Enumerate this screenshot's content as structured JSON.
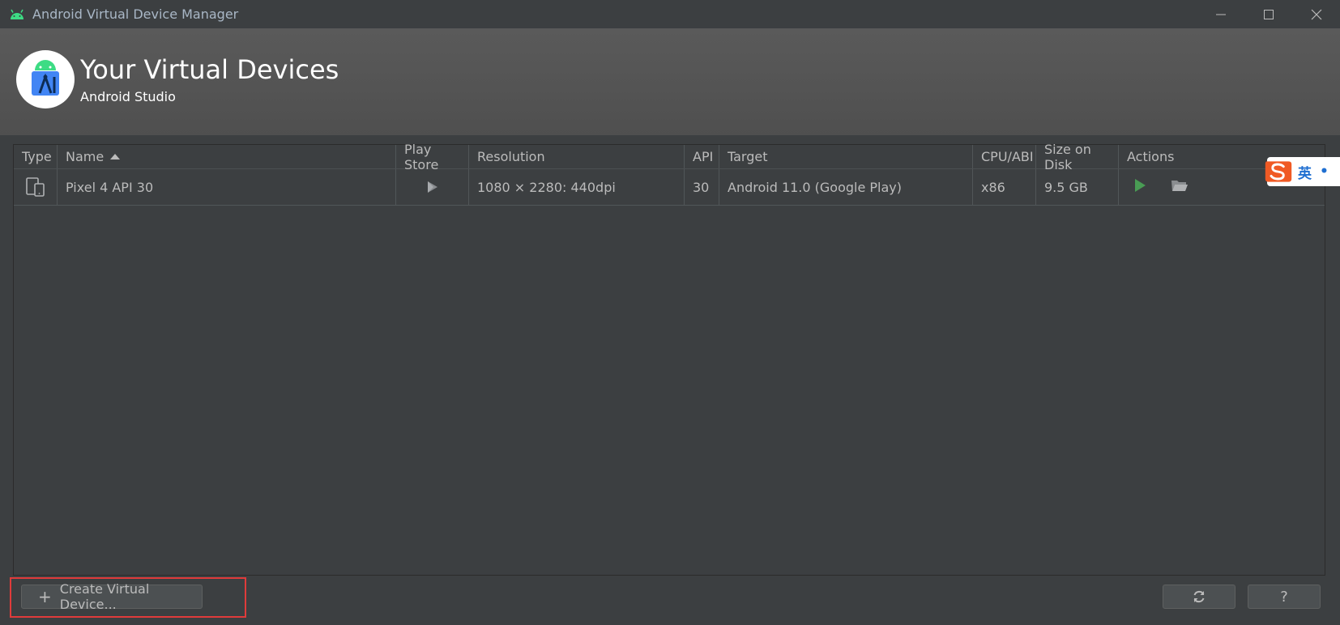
{
  "window": {
    "title": "Android Virtual Device Manager",
    "app_icon": "android-icon"
  },
  "header": {
    "title": "Your Virtual Devices",
    "subtitle": "Android Studio",
    "logo_icon": "android-studio-logo"
  },
  "table": {
    "columns": [
      "Type",
      "Name",
      "Play Store",
      "Resolution",
      "API",
      "Target",
      "CPU/ABI",
      "Size on Disk",
      "Actions"
    ],
    "sorted_by": "Name",
    "rows": [
      {
        "type_icon": "phone-tablet-icon",
        "name": "Pixel 4 API 30",
        "play_store_icon": "play-store-icon",
        "resolution": "1080 × 2280: 440dpi",
        "api": "30",
        "target": "Android 11.0 (Google Play)",
        "cpu_abi": "x86",
        "size_on_disk": "9.5 GB",
        "actions": [
          "play-icon",
          "folder-icon"
        ]
      }
    ]
  },
  "ime": {
    "mode": "英",
    "icon": "sogou-s-icon"
  },
  "footer": {
    "create_label": "Create Virtual Device...",
    "refresh_icon": "refresh-icon",
    "help_label": "?"
  },
  "colors": {
    "accent_green": "#499c54",
    "highlight_red": "#e03b3b",
    "ime_orange": "#f05a24"
  }
}
